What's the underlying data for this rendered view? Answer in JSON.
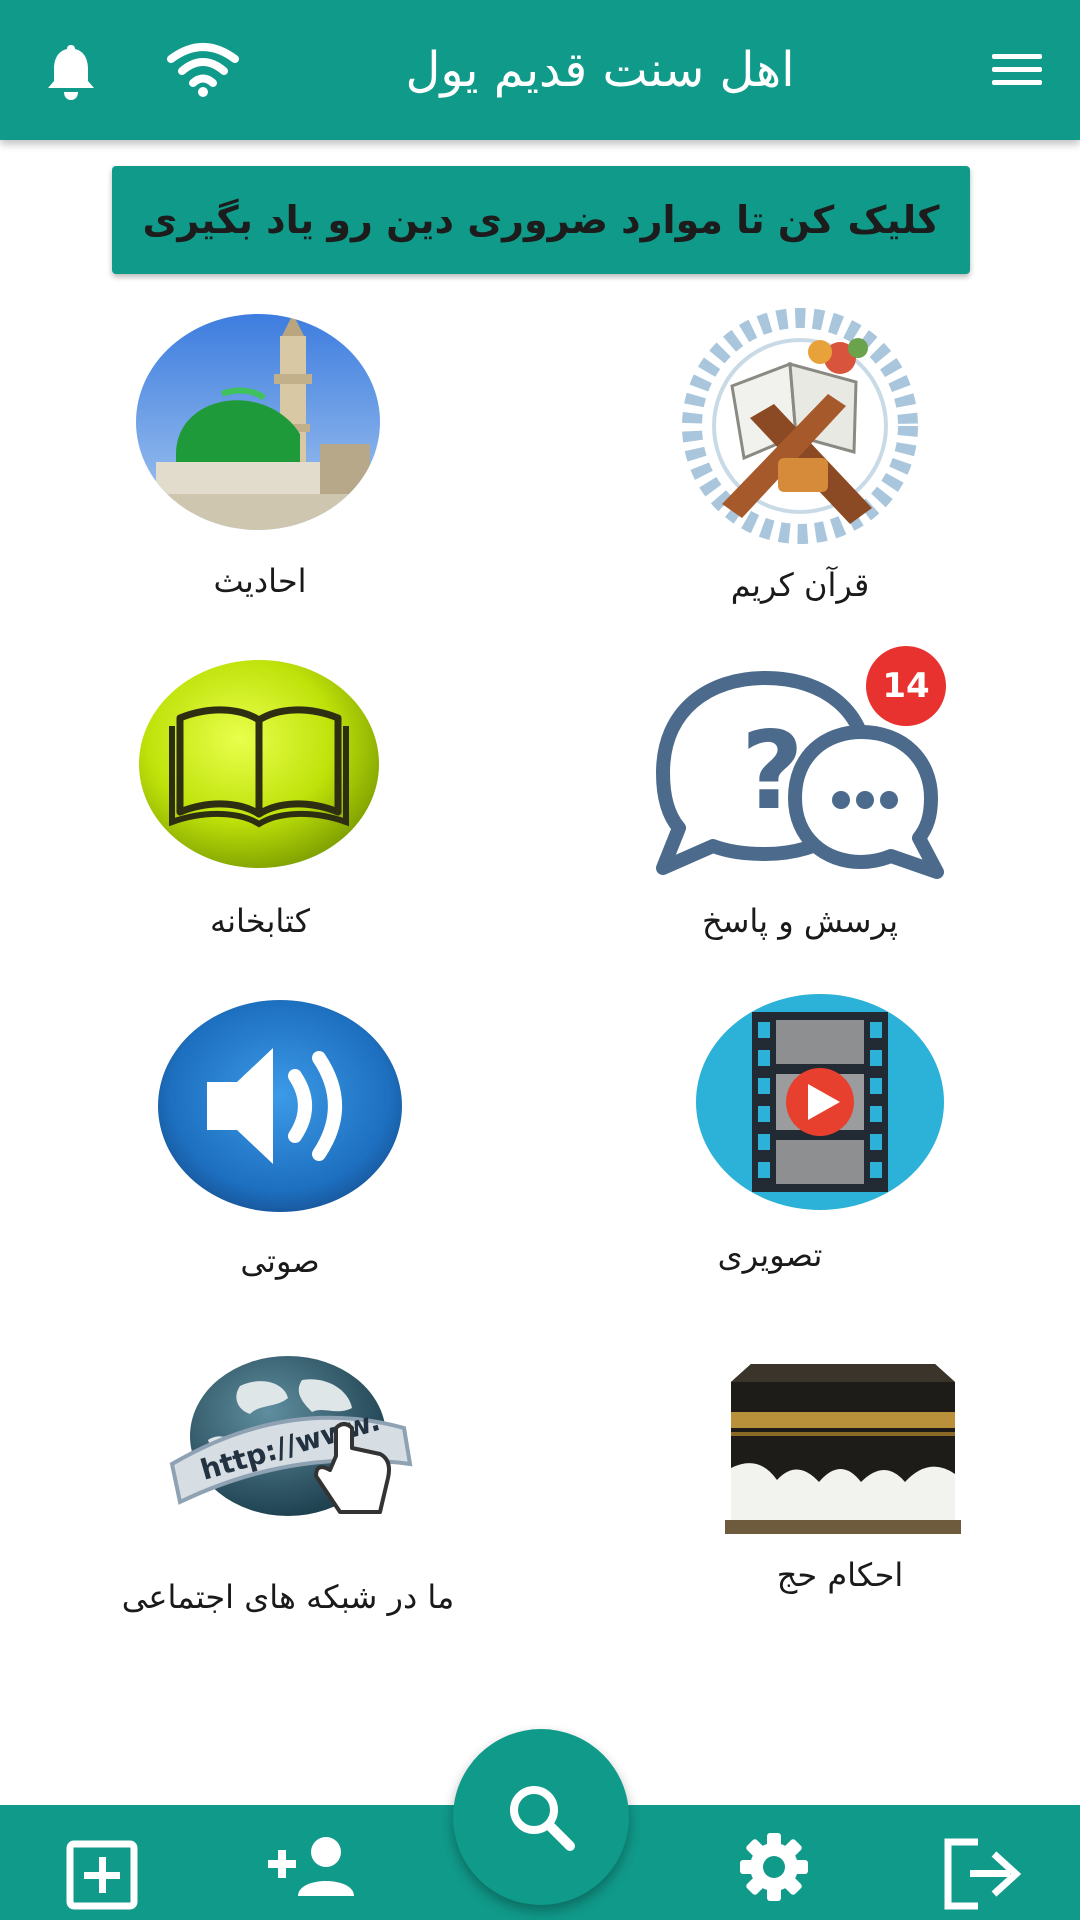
{
  "app": {
    "title": "اهل سنت قدیم یول",
    "banner": "کلیک کن تا موارد ضروری دین رو یاد بگیری"
  },
  "tiles": [
    {
      "label": "قرآن کریم",
      "icon": "quran-icon"
    },
    {
      "label": "احادیث",
      "icon": "mosque-dome-icon"
    },
    {
      "label": "پرسش و پاسخ",
      "icon": "question-answer-icon",
      "badge": "14"
    },
    {
      "label": "کتابخانه",
      "icon": "open-book-icon"
    },
    {
      "label": "تصویری",
      "icon": "video-film-icon"
    },
    {
      "label": "صوتی",
      "icon": "speaker-icon"
    },
    {
      "label": "احکام حج",
      "icon": "kaaba-icon"
    },
    {
      "label": "ما در شبکه های اجتماعی",
      "icon": "globe-www-icon"
    }
  ],
  "colors": {
    "primary": "#109a8a",
    "badge": "#e8322f"
  }
}
